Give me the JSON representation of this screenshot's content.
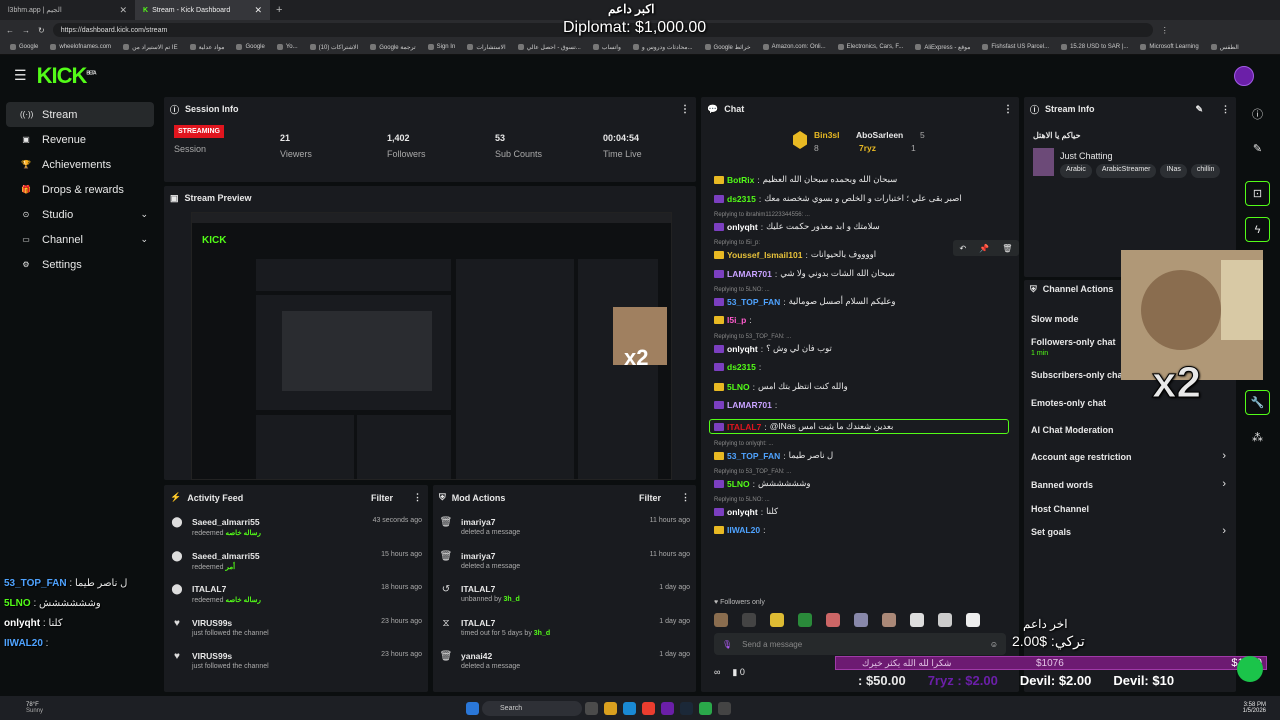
{
  "browser": {
    "tabs": [
      {
        "title": "l3bhm.app | الجيم",
        "active": false
      },
      {
        "title": "Stream - Kick Dashboard",
        "active": true
      }
    ],
    "url": "https://dashboard.kick.com/stream",
    "bookmarks": [
      "Google",
      "wheelofnames.com",
      "تم الاستيراد من IE",
      "مواد عدلية",
      "Google",
      "Yo...",
      "(10) الاشتراكات",
      "Google ترجمة",
      "Sign In",
      "الاستشارات",
      "تسوق - احصل عالي...",
      "واتساب",
      "محادثات ودروس و...",
      "Google خرائط",
      "Amazon.com: Onli...",
      "Electronics, Cars, F...",
      "AliExpress - موقع",
      "Fishsfast US Parcel...",
      "15.28 USD to SAR |...",
      "Microsoft Learning",
      "الطقس"
    ]
  },
  "brand": {
    "logo": "KICK",
    "beta": "BETA"
  },
  "sidebar": {
    "items": [
      {
        "label": "Stream",
        "icon": "broadcast-icon"
      },
      {
        "label": "Revenue",
        "icon": "wallet-icon"
      },
      {
        "label": "Achievements",
        "icon": "trophy-icon"
      },
      {
        "label": "Drops & rewards",
        "icon": "gift-icon"
      },
      {
        "label": "Studio",
        "icon": "camera-icon"
      },
      {
        "label": "Channel",
        "icon": "tv-icon"
      },
      {
        "label": "Settings",
        "icon": "gear-icon"
      }
    ]
  },
  "session": {
    "title": "Session Info",
    "status": "STREAMING",
    "status_label": "Session",
    "viewers": "21",
    "viewers_label": "Viewers",
    "followers": "1,402",
    "followers_label": "Followers",
    "subs": "53",
    "subs_label": "Sub Counts",
    "time": "00:04:54",
    "time_label": "Time Live"
  },
  "preview": {
    "title": "Stream Preview"
  },
  "activity": {
    "title": "Activity Feed",
    "filter": "Filter",
    "rows": [
      {
        "user": "Saeed_almarri55",
        "action": "redeemed",
        "reward": "رساله خاصه",
        "time": "43 seconds ago"
      },
      {
        "user": "Saeed_almarri55",
        "action": "redeemed",
        "reward": "أمر",
        "time": "15 hours ago"
      },
      {
        "user": "ITALAL7",
        "action": "redeemed",
        "reward": "رساله خاصه",
        "time": "18 hours ago"
      },
      {
        "user": "VIRUS99s",
        "action": "just followed the channel",
        "reward": "",
        "time": "23 hours ago"
      },
      {
        "user": "VIRUS99s",
        "action": "just followed the channel",
        "reward": "",
        "time": "23 hours ago"
      }
    ]
  },
  "mod": {
    "title": "Mod Actions",
    "filter": "Filter",
    "rows": [
      {
        "user": "imariya7",
        "action": "deleted a message",
        "by": "",
        "time": "11 hours ago"
      },
      {
        "user": "imariya7",
        "action": "deleted a message",
        "by": "",
        "time": "11 hours ago"
      },
      {
        "user": "ITALAL7",
        "action": "unbanned by",
        "by": "3h_d",
        "time": "1 day ago"
      },
      {
        "user": "ITALAL7",
        "action": "timed out for 5 days by",
        "by": "3h_d",
        "time": "1 day ago"
      },
      {
        "user": "yanai42",
        "action": "deleted a message",
        "by": "",
        "time": "1 day ago"
      }
    ]
  },
  "chat": {
    "title": "Chat",
    "top": [
      {
        "name": "Bin3sl",
        "count": "8",
        "rank": "1"
      },
      {
        "name": "AboSarleen",
        "count": "5",
        "rank": ""
      },
      {
        "name": "7ryz",
        "count": "1",
        "rank": ""
      }
    ],
    "lines": [
      {
        "reply": "",
        "user": "BotRix",
        "color": "#53fc18",
        "text": "سبحان الله وبحمده سبحان الله العظيم"
      },
      {
        "reply": "",
        "user": "ds2315",
        "color": "#53fc18",
        "text": "اصبر بقى علي ؛ اختبارات و الخلص و بسوي شخصنه معك"
      },
      {
        "reply": "Replying to ibrahim11223344556: ...",
        "user": "onlyqht",
        "color": "#ffffff",
        "text": "سلامتك و ابد معذور حكمت عليك"
      },
      {
        "reply": "Replying to l5i_p:",
        "user": "Youssef_Ismail101",
        "color": "#e8c23a",
        "text": "اووووف بالحيوانات"
      },
      {
        "reply": "",
        "user": "LAMAR701",
        "color": "#c8a2ff",
        "text": "سبحان الله الشات بدوني ولا شي"
      },
      {
        "reply": "Replying to 5LNO: ...",
        "user": "53_TOP_FAN",
        "color": "#4fa3ff",
        "text": "وعليكم السلام أصسل صومالية"
      },
      {
        "reply": "",
        "user": "l5i_p",
        "color": "#ff5ccd",
        "text": ""
      },
      {
        "reply": "Replying to 53_TOP_FAN: ...",
        "user": "onlyqht",
        "color": "#ffffff",
        "text": "توب فان لي وش ؟"
      },
      {
        "reply": "",
        "user": "ds2315",
        "color": "#53fc18",
        "text": ""
      },
      {
        "reply": "",
        "user": "5LNO",
        "color": "#53fc18",
        "text": "والله كنت انتظر بتك امس"
      },
      {
        "reply": "",
        "user": "LAMAR701",
        "color": "#c8a2ff",
        "text": ""
      },
      {
        "reply": "",
        "user": "ITALAL7",
        "color": "#e1151e",
        "text": "@INas  بعدين شعندك ما بثيت امس"
      },
      {
        "reply": "Replying to onlyqht: ...",
        "user": "53_TOP_FAN",
        "color": "#4fa3ff",
        "text": "ل ناصر طيما"
      },
      {
        "reply": "Replying to 53_TOP_FAN: ...",
        "user": "5LNO",
        "color": "#53fc18",
        "text": "وشششششش"
      },
      {
        "reply": "Replying to 5LNO: ...",
        "user": "onlyqht",
        "color": "#ffffff",
        "text": "كلنا"
      },
      {
        "reply": "",
        "user": "IIWAL20",
        "color": "#4fa3ff",
        "text": ""
      }
    ],
    "followers_only": "Followers only",
    "placeholder": "Send a message",
    "points": "0"
  },
  "stream_info": {
    "title": "Stream Info",
    "stream_title": "حياكم يا الاهتل",
    "category": "Just Chatting",
    "tags": [
      "Arabic",
      "ArabicStreamer",
      "INas",
      "chillin"
    ]
  },
  "channel_actions": {
    "title": "Channel Actions",
    "rows": [
      {
        "label": "Slow mode",
        "sub": "",
        "arrow": false
      },
      {
        "label": "Followers-only chat",
        "sub": "1 min",
        "arrow": false
      },
      {
        "label": "Subscribers-only chat",
        "sub": "",
        "arrow": false
      },
      {
        "label": "Emotes-only chat",
        "sub": "",
        "arrow": false
      },
      {
        "label": "AI Chat Moderation",
        "sub": "",
        "arrow": false
      },
      {
        "label": "Account age restriction",
        "sub": "",
        "arrow": true
      },
      {
        "label": "Banned words",
        "sub": "",
        "arrow": true
      },
      {
        "label": "Host Channel",
        "sub": "",
        "arrow": false
      },
      {
        "label": "Set goals",
        "sub": "",
        "arrow": true
      }
    ]
  },
  "overlay": {
    "top_name": "اكبر داعم",
    "top_amount": "Diplomat: $1,000.00",
    "last_name": "اخر داعم",
    "last_amount": "2.00$ :تركي",
    "multiplier": "x2",
    "goal_left": "$1076",
    "goal_right": "$1000",
    "goal_text": "شكرا لله الله يكثر خيرك",
    "ticker": [
      ": $50.00",
      "7ryz : $2.00",
      "Devil: $2.00",
      "Devil: $10"
    ],
    "left_chat": [
      {
        "user": "53_TOP_FAN",
        "text": "ل ناصر طيما"
      },
      {
        "user": "5LNO",
        "text": "وشششششش"
      },
      {
        "user": "onlyqht",
        "text": "كلنا"
      },
      {
        "user": "IIWAL20",
        "text": ""
      }
    ]
  },
  "taskbar": {
    "weather": "78°F",
    "weather_sub": "Sunny",
    "search": "Search",
    "time": "3:58 PM",
    "date": "1/5/2026"
  },
  "colors": {
    "accent": "#53fc18",
    "live": "#e1151e",
    "panel": "#191b1f",
    "bg": "#0b0e0f"
  }
}
